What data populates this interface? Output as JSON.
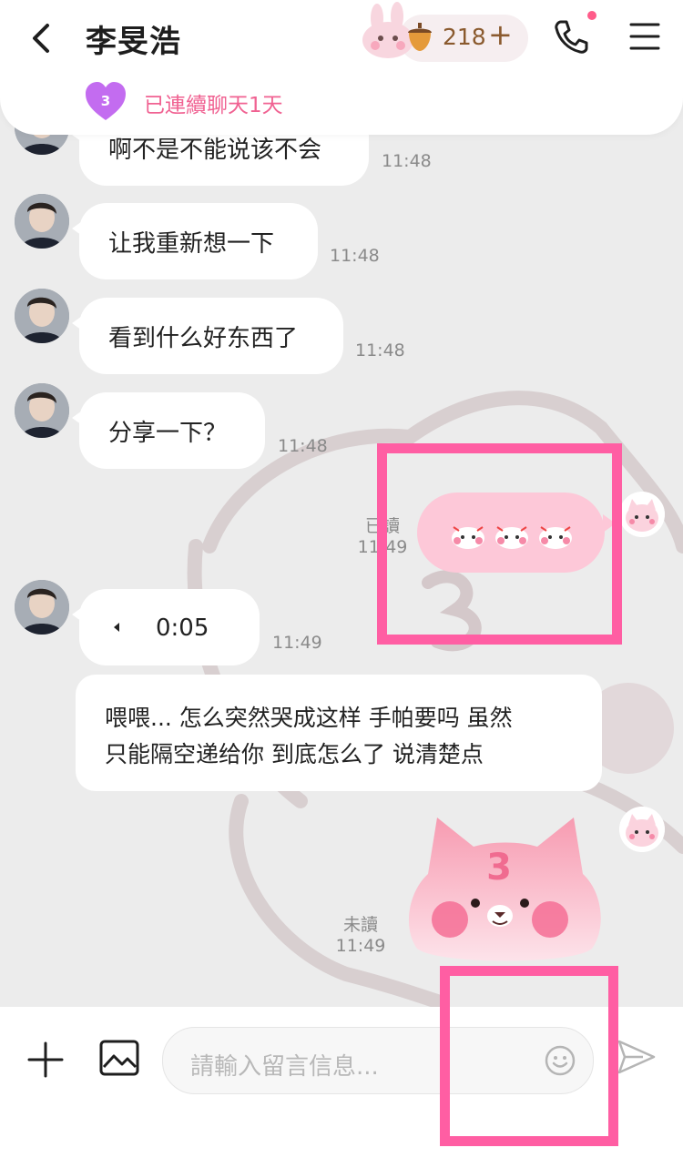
{
  "header": {
    "contact_name": "李旻浩",
    "coin_count": "218",
    "coin_plus": "+",
    "streak_level": "3",
    "streak_text": "已連續聊天1天"
  },
  "messages": [
    {
      "text": "啊不是不能说该不会",
      "time": "11:48"
    },
    {
      "text": "让我重新想一下",
      "time": "11:48"
    },
    {
      "text": "看到什么好东西了",
      "time": "11:48"
    },
    {
      "text": "分享一下？",
      "time": "11:48"
    }
  ],
  "sent_sticker": {
    "receipt": "已讀",
    "time": "11:49"
  },
  "voice": {
    "duration": "0:05",
    "time": "11:49"
  },
  "long_message": {
    "line1": "喂喂... 怎么突然哭成这样 手帕要吗 虽然",
    "line2": "只能隔空递给你 到底怎么了 说清楚点"
  },
  "sent_big_sticker": {
    "receipt": "未讀",
    "time": "11:49",
    "mark": "3"
  },
  "input": {
    "placeholder": "請輸入留言信息..."
  },
  "colors": {
    "accent": "#ff5ea3",
    "streak": "#f06292",
    "sticker_bubble": "#fdc8d8"
  }
}
